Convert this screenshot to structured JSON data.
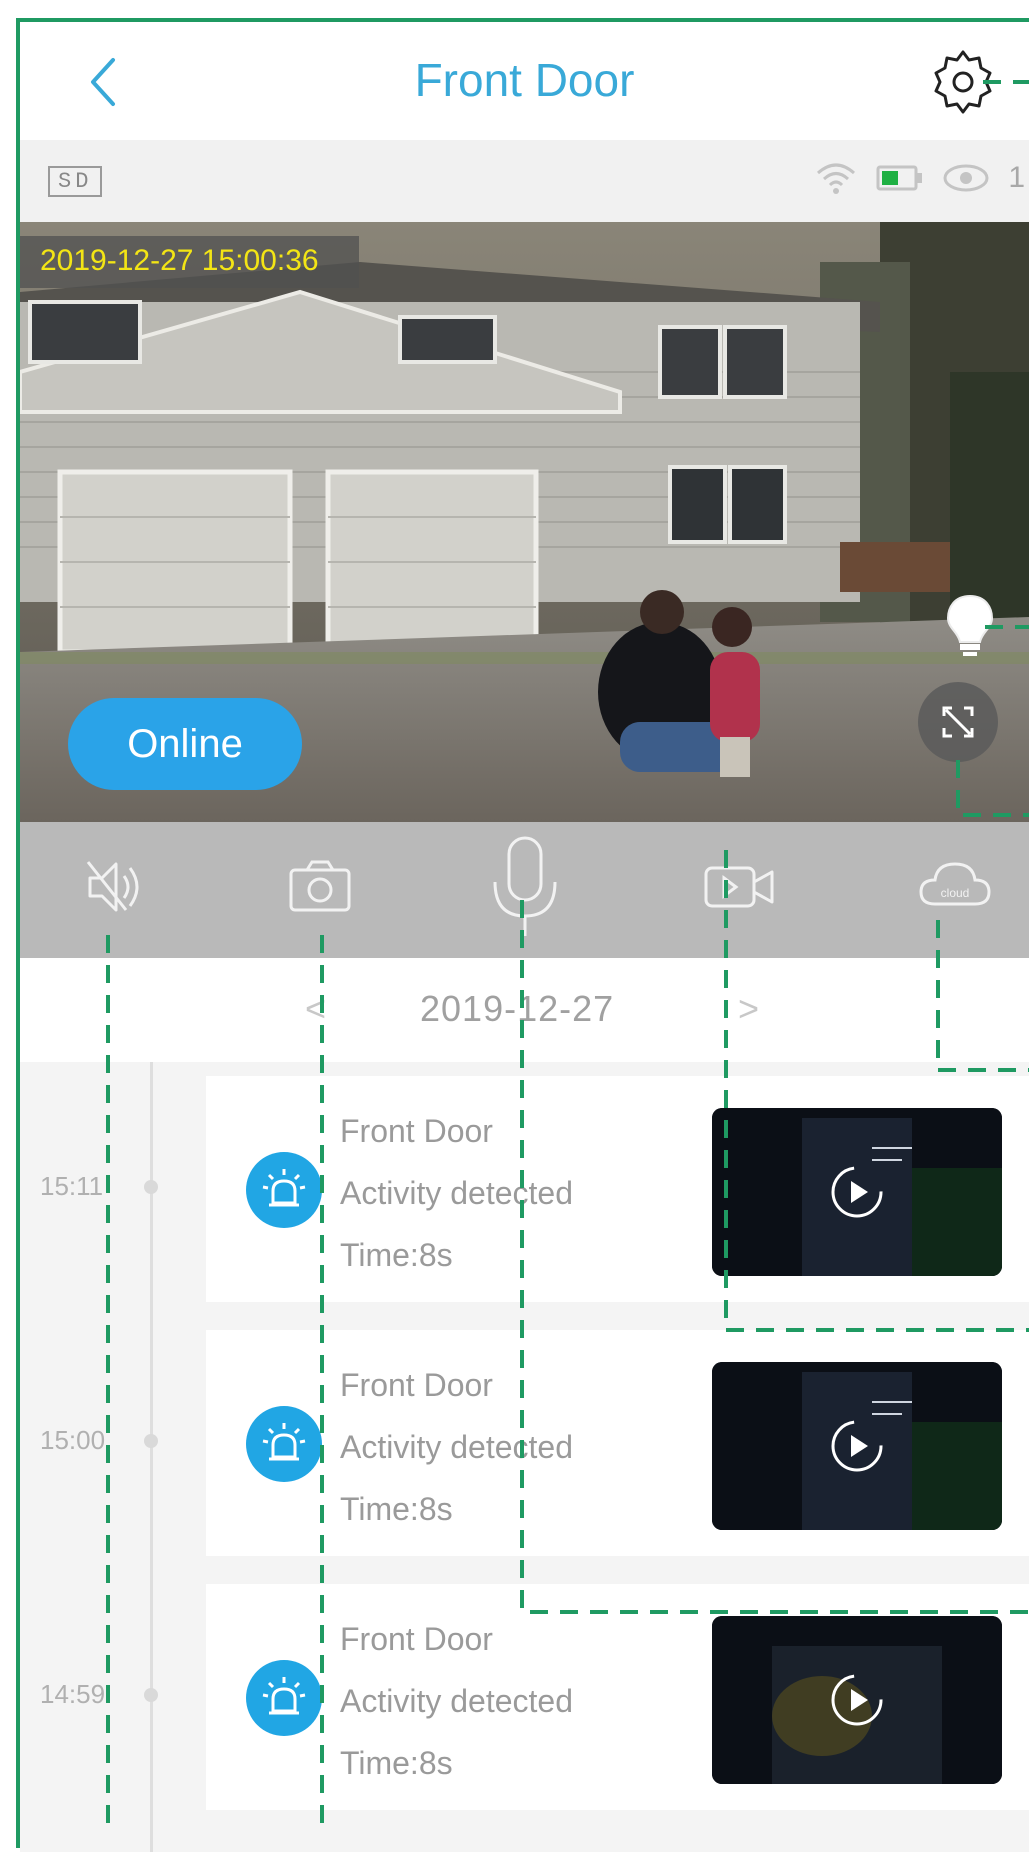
{
  "header": {
    "title": "Front Door"
  },
  "status": {
    "sd_label": "SD",
    "viewer_count": "1"
  },
  "video": {
    "timestamp": "2019-12-27  15:00:36",
    "status_label": "Online"
  },
  "controls": [
    {
      "name": "mute-toggle",
      "icon": "speaker-muted-icon"
    },
    {
      "name": "snapshot",
      "icon": "camera-icon"
    },
    {
      "name": "talk",
      "icon": "microphone-icon"
    },
    {
      "name": "record",
      "icon": "video-record-icon"
    },
    {
      "name": "cloud",
      "icon": "cloud-icon",
      "label": "cloud"
    }
  ],
  "date_nav": {
    "prev": "<",
    "date": "2019-12-27",
    "next": ">"
  },
  "events": [
    {
      "time": "15:11",
      "device": "Front Door",
      "event": "Activity detected",
      "duration": "Time:8s"
    },
    {
      "time": "15:00",
      "device": "Front Door",
      "event": "Activity detected",
      "duration": "Time:8s"
    },
    {
      "time": "14:59",
      "device": "Front Door",
      "event": "Activity detected",
      "duration": "Time:8s"
    }
  ],
  "colors": {
    "accent": "#39a9d8",
    "online": "#2aa3e8",
    "event_icon": "#21a6e4",
    "timestamp": "#f3e515",
    "annotation": "#1f9a62"
  }
}
